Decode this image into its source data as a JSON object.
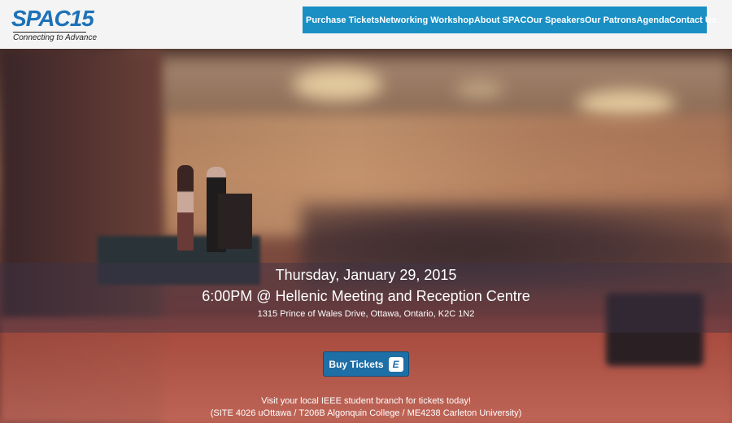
{
  "logo": {
    "wordmark": "SPAC15",
    "tagline": "Connecting to Advance"
  },
  "nav": {
    "items": [
      {
        "label": "Purchase Tickets"
      },
      {
        "label": "Networking Workshop"
      },
      {
        "label": "About SPAC"
      },
      {
        "label": "Our Speakers"
      },
      {
        "label": "Our Patrons"
      },
      {
        "label": "Agenda"
      },
      {
        "label": "Contact Us"
      }
    ]
  },
  "hero": {
    "date": "Thursday, January 29, 2015",
    "time_venue": "6:00PM @ Hellenic Meeting and Reception Centre",
    "address": "1315 Prince of Wales Drive, Ottawa, Ontario, K2C 1N2",
    "buy_button": {
      "label": "Buy Tickets",
      "icon": "eventbrite-icon",
      "icon_glyph": "E"
    },
    "visit_text": "Visit your local IEEE student branch for tickets today!",
    "sites_text": "(SITE 4026 uOttawa / T206B Algonquin College / ME4238 Carleton University)"
  },
  "colors": {
    "brand_blue": "#1d72b8",
    "nav_background": "#1a8fc4",
    "button_blue": "#1e6fa6"
  }
}
